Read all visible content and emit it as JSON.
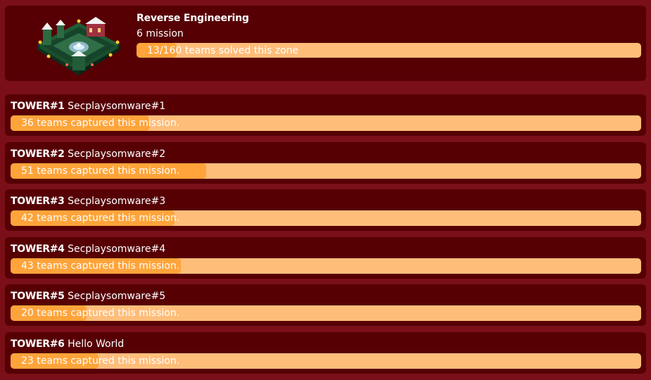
{
  "zone": {
    "title": "Reverse Engineering",
    "mission_count": "6 mission",
    "progress_label": "13/160 teams solved this zone",
    "progress": 0.08
  },
  "missions": [
    {
      "tower": "TOWER#1",
      "name": "Secplaysomware#1",
      "captured_label": "36 teams captured this mission.",
      "progress": 0.22
    },
    {
      "tower": "TOWER#2",
      "name": "Secplaysomware#2",
      "captured_label": "51 teams captured this mission.",
      "progress": 0.31
    },
    {
      "tower": "TOWER#3",
      "name": "Secplaysomware#3",
      "captured_label": "42 teams captured this mission.",
      "progress": 0.26
    },
    {
      "tower": "TOWER#4",
      "name": "Secplaysomware#4",
      "captured_label": "43 teams captured this mission.",
      "progress": 0.27
    },
    {
      "tower": "TOWER#5",
      "name": "Secplaysomware#5",
      "captured_label": "20 teams captured this mission.",
      "progress": 0.12
    },
    {
      "tower": "TOWER#6",
      "name": "Hello World",
      "captured_label": "23 teams captured this mission.",
      "progress": 0.14
    }
  ],
  "colors": {
    "page_bg": "#7a0f17",
    "card_bg": "#560004",
    "bar_track": "#ffbd7a",
    "bar_fill": "#ffa43a"
  }
}
